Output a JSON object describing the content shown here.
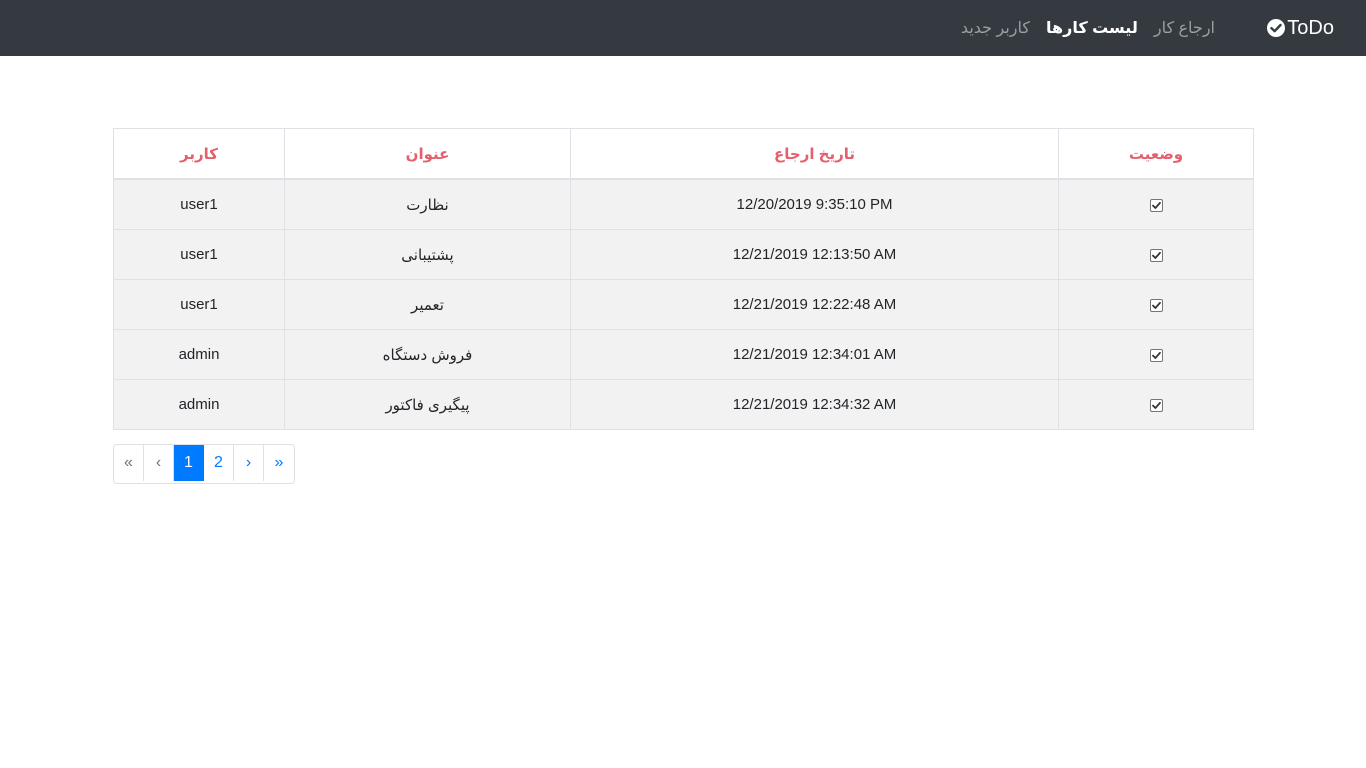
{
  "navbar": {
    "brand": "ToDo",
    "links": [
      {
        "label": "ارجاع کار",
        "active": false
      },
      {
        "label": "لیست کارها",
        "active": true
      },
      {
        "label": "کاربر جدید",
        "active": false
      }
    ]
  },
  "table": {
    "headers": {
      "status": "وضعیت",
      "date": "تاریخ ارجاع",
      "title": "عنوان",
      "user": "کاربر"
    },
    "rows": [
      {
        "status": true,
        "date": "12/20/2019 9:35:10 PM",
        "title": "نظارت",
        "user": "user1"
      },
      {
        "status": true,
        "date": "12/21/2019 12:13:50 AM",
        "title": "پشتیبانی",
        "user": "user1"
      },
      {
        "status": true,
        "date": "12/21/2019 12:22:48 AM",
        "title": "تعمیر",
        "user": "user1"
      },
      {
        "status": true,
        "date": "12/21/2019 12:34:01 AM",
        "title": "فروش دستگاه",
        "user": "admin"
      },
      {
        "status": true,
        "date": "12/21/2019 12:34:32 AM",
        "title": "پیگیری فاکتور",
        "user": "admin"
      }
    ]
  },
  "pagination": {
    "first": "«",
    "prev": "‹",
    "pages": [
      "1",
      "2"
    ],
    "next": "›",
    "last": "»",
    "current": "1"
  },
  "colors": {
    "navbar_bg": "#343a40",
    "header_text": "#e4606d",
    "accent": "#007bff"
  }
}
